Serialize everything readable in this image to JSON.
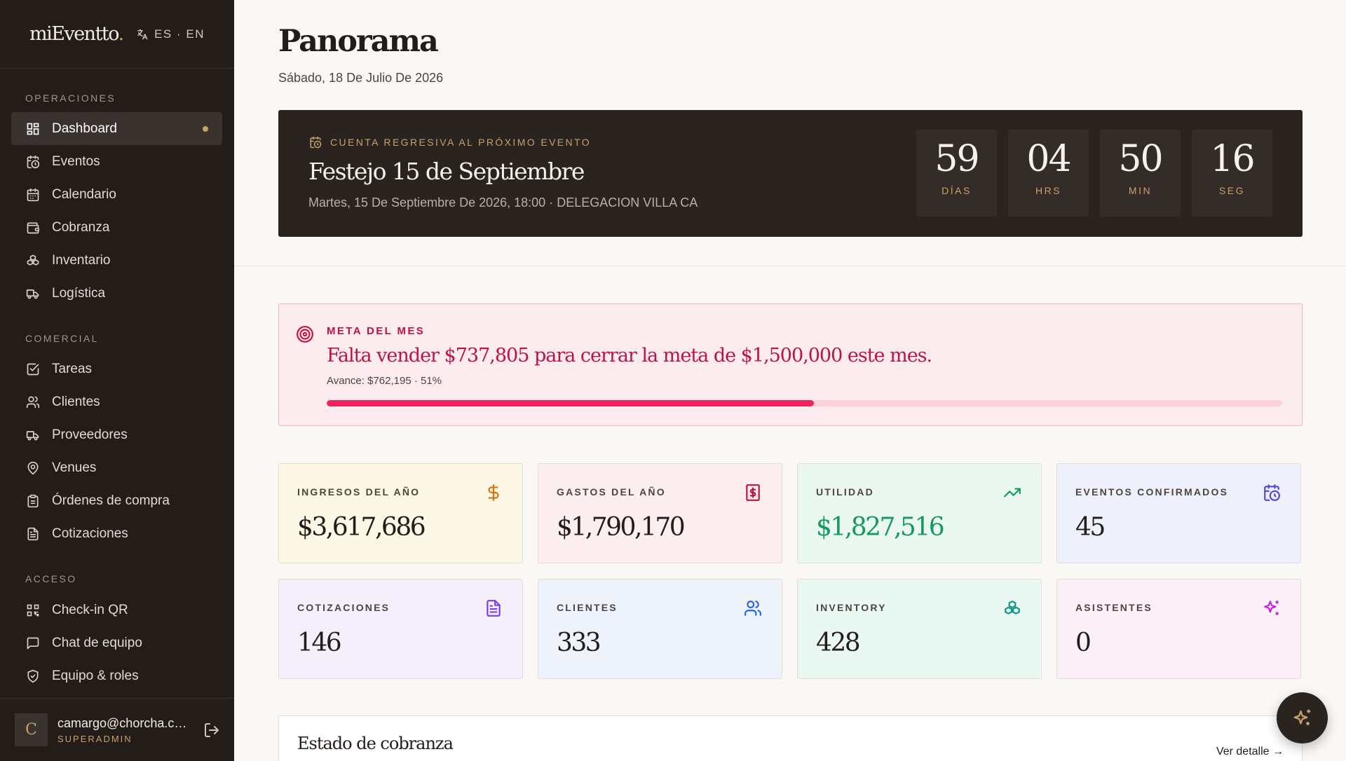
{
  "brand": {
    "logo": "miEventto",
    "logo_dot": ".",
    "lang": "ES · EN"
  },
  "sidebar": {
    "sections": [
      {
        "label": "OPERACIONES"
      },
      {
        "label": "COMERCIAL"
      },
      {
        "label": "ACCESO"
      }
    ],
    "items": [
      {
        "label": "Dashboard",
        "icon": "dashboard-icon",
        "active": true
      },
      {
        "label": "Eventos",
        "icon": "calendar-clock-icon"
      },
      {
        "label": "Calendario",
        "icon": "calendar-icon"
      },
      {
        "label": "Cobranza",
        "icon": "wallet-icon"
      },
      {
        "label": "Inventario",
        "icon": "boxes-icon"
      },
      {
        "label": "Logística",
        "icon": "truck-icon"
      },
      {
        "label": "Tareas",
        "icon": "checkbox-icon"
      },
      {
        "label": "Clientes",
        "icon": "users-icon"
      },
      {
        "label": "Proveedores",
        "icon": "truck-icon"
      },
      {
        "label": "Venues",
        "icon": "map-pin-icon"
      },
      {
        "label": "Órdenes de compra",
        "icon": "clipboard-icon"
      },
      {
        "label": "Cotizaciones",
        "icon": "document-icon"
      },
      {
        "label": "Check-in QR",
        "icon": "qr-code-icon"
      },
      {
        "label": "Chat de equipo",
        "icon": "chat-icon"
      },
      {
        "label": "Equipo & roles",
        "icon": "shield-icon"
      }
    ]
  },
  "user": {
    "initial": "C",
    "email": "camargo@chorcha.com",
    "role": "SUPERADMIN"
  },
  "header": {
    "title": "Panorama",
    "date": "Sábado, 18 De Julio De 2026"
  },
  "countdown": {
    "eyebrow": "CUENTA REGRESIVA AL PRÓXIMO EVENTO",
    "event_name": "Festejo 15 de Septiembre",
    "details": "Martes, 15 De Septiembre De 2026, 18:00 · DELEGACION VILLA CA",
    "units": [
      {
        "value": "59",
        "label": "DÍAS"
      },
      {
        "value": "04",
        "label": "HRS"
      },
      {
        "value": "50",
        "label": "MIN"
      },
      {
        "value": "16",
        "label": "SEG"
      }
    ]
  },
  "goal": {
    "eyebrow": "META DEL MES",
    "message": "Falta vender $737,805 para cerrar la meta de $1,500,000 este mes.",
    "progress_text": "Avance: $762,195 · 51%",
    "progress": 0.51
  },
  "stats": [
    {
      "label": "INGRESOS DEL AÑO",
      "value": "$3,617,686",
      "icon": "dollar-icon",
      "bg": "#fdf8e6",
      "accent": "#d9730d"
    },
    {
      "label": "GASTOS DEL AÑO",
      "value": "$1,790,170",
      "icon": "receipt-icon",
      "bg": "#fdeff0",
      "accent": "#c0123f"
    },
    {
      "label": "UTILIDAD",
      "value": "$1,827,516",
      "icon": "trending-up-icon",
      "bg": "#eaf8f1",
      "accent": "#149a5a"
    },
    {
      "label": "EVENTOS CONFIRMADOS",
      "value": "45",
      "icon": "calendar-clock-icon",
      "bg": "#eef0fb",
      "accent": "#4f46e5"
    },
    {
      "label": "COTIZACIONES",
      "value": "146",
      "icon": "document-icon",
      "bg": "#f3f0fb",
      "accent": "#7c3aed"
    },
    {
      "label": "CLIENTES",
      "value": "333",
      "icon": "users-icon",
      "bg": "#eef3fb",
      "accent": "#2563eb"
    },
    {
      "label": "INVENTORY",
      "value": "428",
      "icon": "boxes-icon",
      "bg": "#eaf8f3",
      "accent": "#0d9488"
    },
    {
      "label": "ASISTENTES",
      "value": "0",
      "icon": "sparkles-icon",
      "bg": "#fbf0f8",
      "accent": "#c026d3"
    }
  ],
  "cobranza": {
    "title": "Estado de cobranza",
    "link": "Ver detalle →"
  },
  "colors": {
    "gold": "#c9a06a",
    "sidebar_bg": "#231d1a",
    "goal_red": "#f0245a"
  }
}
